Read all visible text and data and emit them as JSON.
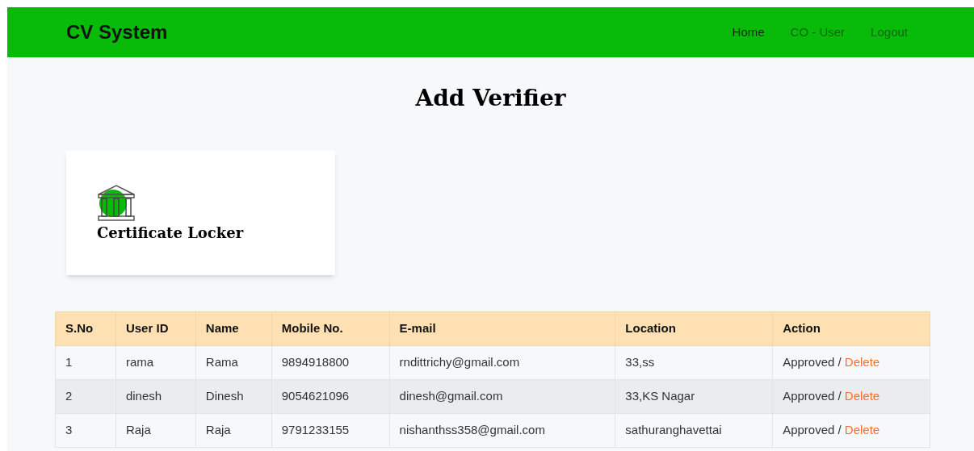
{
  "navbar": {
    "brand": "CV System",
    "links": [
      {
        "label": "Home",
        "selected": true
      },
      {
        "label": "CO - User",
        "selected": false
      },
      {
        "label": "Logout",
        "selected": false
      }
    ]
  },
  "page_title": "Add Verifier",
  "logo_card": {
    "caption": "Certificate Locker"
  },
  "table": {
    "columns": [
      "S.No",
      "User ID",
      "Name",
      "Mobile No.",
      "E-mail",
      "Location",
      "Action"
    ],
    "rows": [
      {
        "cells": [
          "1",
          "rama",
          "Rama",
          "9894918800",
          "rndittrichy@gmail.com",
          "33,ss"
        ],
        "status": "Approved /",
        "action": "Delete"
      },
      {
        "cells": [
          "2",
          "dinesh",
          "Dinesh",
          "9054621096",
          "dinesh@gmail.com",
          "33,KS Nagar"
        ],
        "status": "Approved /",
        "action": "Delete"
      },
      {
        "cells": [
          "3",
          "Raja",
          "Raja",
          "9791233155",
          "nishanthss358@gmail.com",
          "sathuranghavettai"
        ],
        "status": "Approved /",
        "action": "Delete"
      }
    ]
  }
}
